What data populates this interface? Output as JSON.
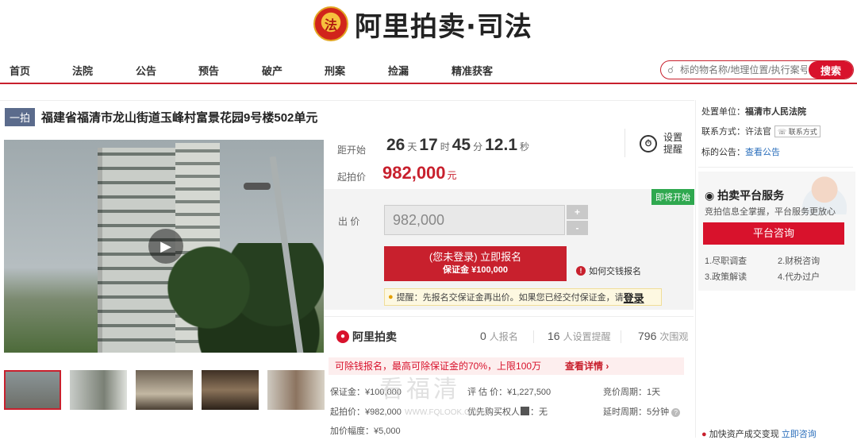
{
  "brand": {
    "emblem_text": "法",
    "name": "阿里拍卖·司法"
  },
  "nav": {
    "items": [
      "首页",
      "法院",
      "公告",
      "预告",
      "破产",
      "刑案",
      "捡漏",
      "精准获客"
    ]
  },
  "search": {
    "placeholder": "标的物名称/地理位置/执行案号",
    "button": "搜索"
  },
  "listing": {
    "badge": "一拍",
    "title": "福建省福清市龙山街道玉峰村富景花园9号楼502单元"
  },
  "countdown": {
    "label": "距开始",
    "days": "26",
    "days_unit": "天",
    "hours": "17",
    "hours_unit": "时",
    "minutes": "45",
    "minutes_unit": "分",
    "seconds": "12.1",
    "seconds_unit": "秒"
  },
  "remind": {
    "line1": "设置",
    "line2": "提醒"
  },
  "start_price": {
    "label": "起拍价",
    "value": "982,000",
    "unit": "元"
  },
  "bid": {
    "soon_badge": "即将开始",
    "label": "出 价",
    "value": "982,000",
    "plus": "+",
    "minus": "-"
  },
  "signup": {
    "line1": "(您未登录) 立即报名",
    "line2": "保证金 ¥100,000"
  },
  "howpay": "如何交钱报名",
  "notice": {
    "text": "提醒：先报名交保证金再出价。如果您已经交付保证金，请",
    "link": "登录"
  },
  "stats": {
    "platform": "阿里拍卖",
    "signups": "0",
    "signups_label": "人报名",
    "reminders": "16",
    "reminders_label": "人设置提醒",
    "views": "796",
    "views_label": "次围观"
  },
  "loan": {
    "text": "可除钱报名，最高可除保证金的70%，上限100万",
    "more": "查看详情 ›"
  },
  "info": {
    "deposit": "保证金：¥100,000",
    "appraisal": "评 估 价：¥1,227,500",
    "cycle": "竞价周期：1天",
    "start": "起拍价：¥982,000",
    "priority": "优先购买权人",
    "priority_val": "：无",
    "delay": "延时周期：5分钟",
    "increment": "加价幅度：¥5,000"
  },
  "watermark": {
    "main": "看福清",
    "sub": "WWW.FQLOOK.COM"
  },
  "right": {
    "unit_label": "处置单位：",
    "unit_value": "福清市人民法院",
    "contact_label": "联系方式：许法官",
    "contact_btn": "联系方式",
    "announce_label": "标的公告：",
    "announce_link": "查看公告",
    "svc_title": "拍卖平台服务",
    "svc_sub": "竞拍信息全掌握，平台服务更放心",
    "svc_btn": "平台咨询",
    "svc_items": [
      "1.尽职调查",
      "2.财税咨询",
      "3.政策解读",
      "4.代办过户"
    ],
    "fast_text": "加快资产成交变现",
    "fast_link": "立即咨询"
  }
}
